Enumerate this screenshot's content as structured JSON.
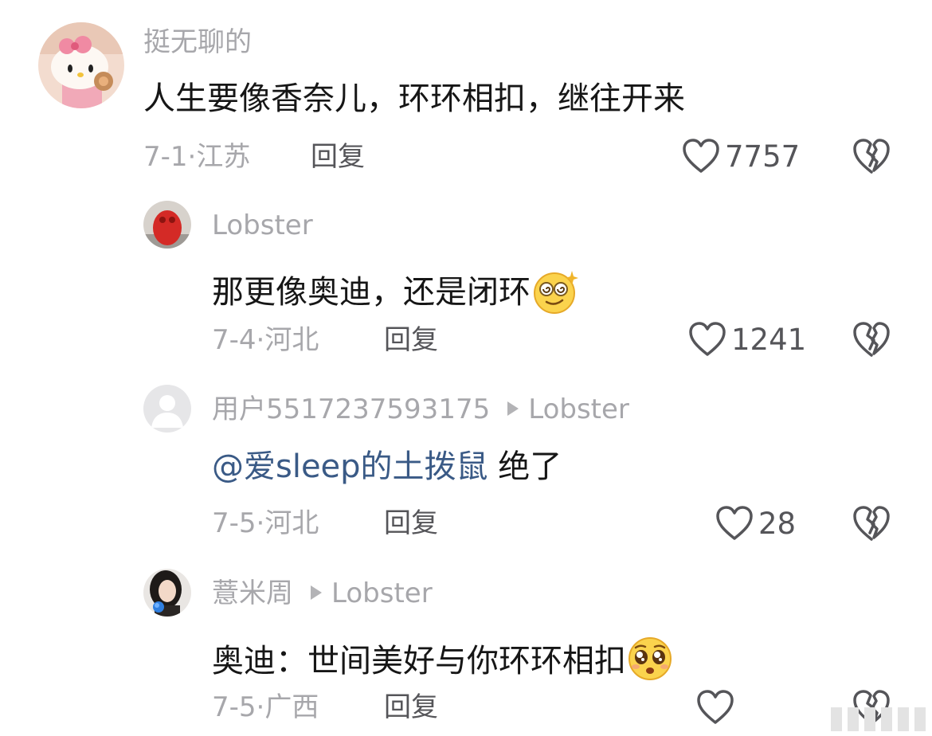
{
  "comments": [
    {
      "username": "挺无聊的",
      "text": "人生要像香奈儿，环环相扣，继往开来",
      "date": "7-1",
      "location": "江苏",
      "reply_label": "回复",
      "likes": "7757",
      "avatar": "hello-kitty-avatar"
    },
    {
      "username": "Lobster",
      "text": "那更像奥迪，还是闭环",
      "date": "7-4",
      "location": "河北",
      "reply_label": "回复",
      "likes": "1241",
      "avatar": "red-figure-avatar",
      "emoji": "dizzy-face-emoji"
    },
    {
      "username": "用户5517237593175",
      "reply_to": "Lobster",
      "mention": "@爱sleep的土拨鼠",
      "text": "绝了",
      "date": "7-5",
      "location": "河北",
      "reply_label": "回复",
      "likes": "28",
      "avatar": "default-user-avatar"
    },
    {
      "username": "薏米周",
      "reply_to": "Lobster",
      "text": "奥迪：世间美好与你环环相扣",
      "date": "7-5",
      "location": "广西",
      "reply_label": "回复",
      "likes": "",
      "avatar": "girl-photo-avatar",
      "emoji": "pleading-face-emoji"
    }
  ],
  "icons": {
    "like": "heart-outline-icon",
    "dislike": "broken-heart-icon"
  },
  "colors": {
    "text": "#161616",
    "meta": "#a7a7ab",
    "action": "#555559",
    "mention": "#3a5a86"
  }
}
